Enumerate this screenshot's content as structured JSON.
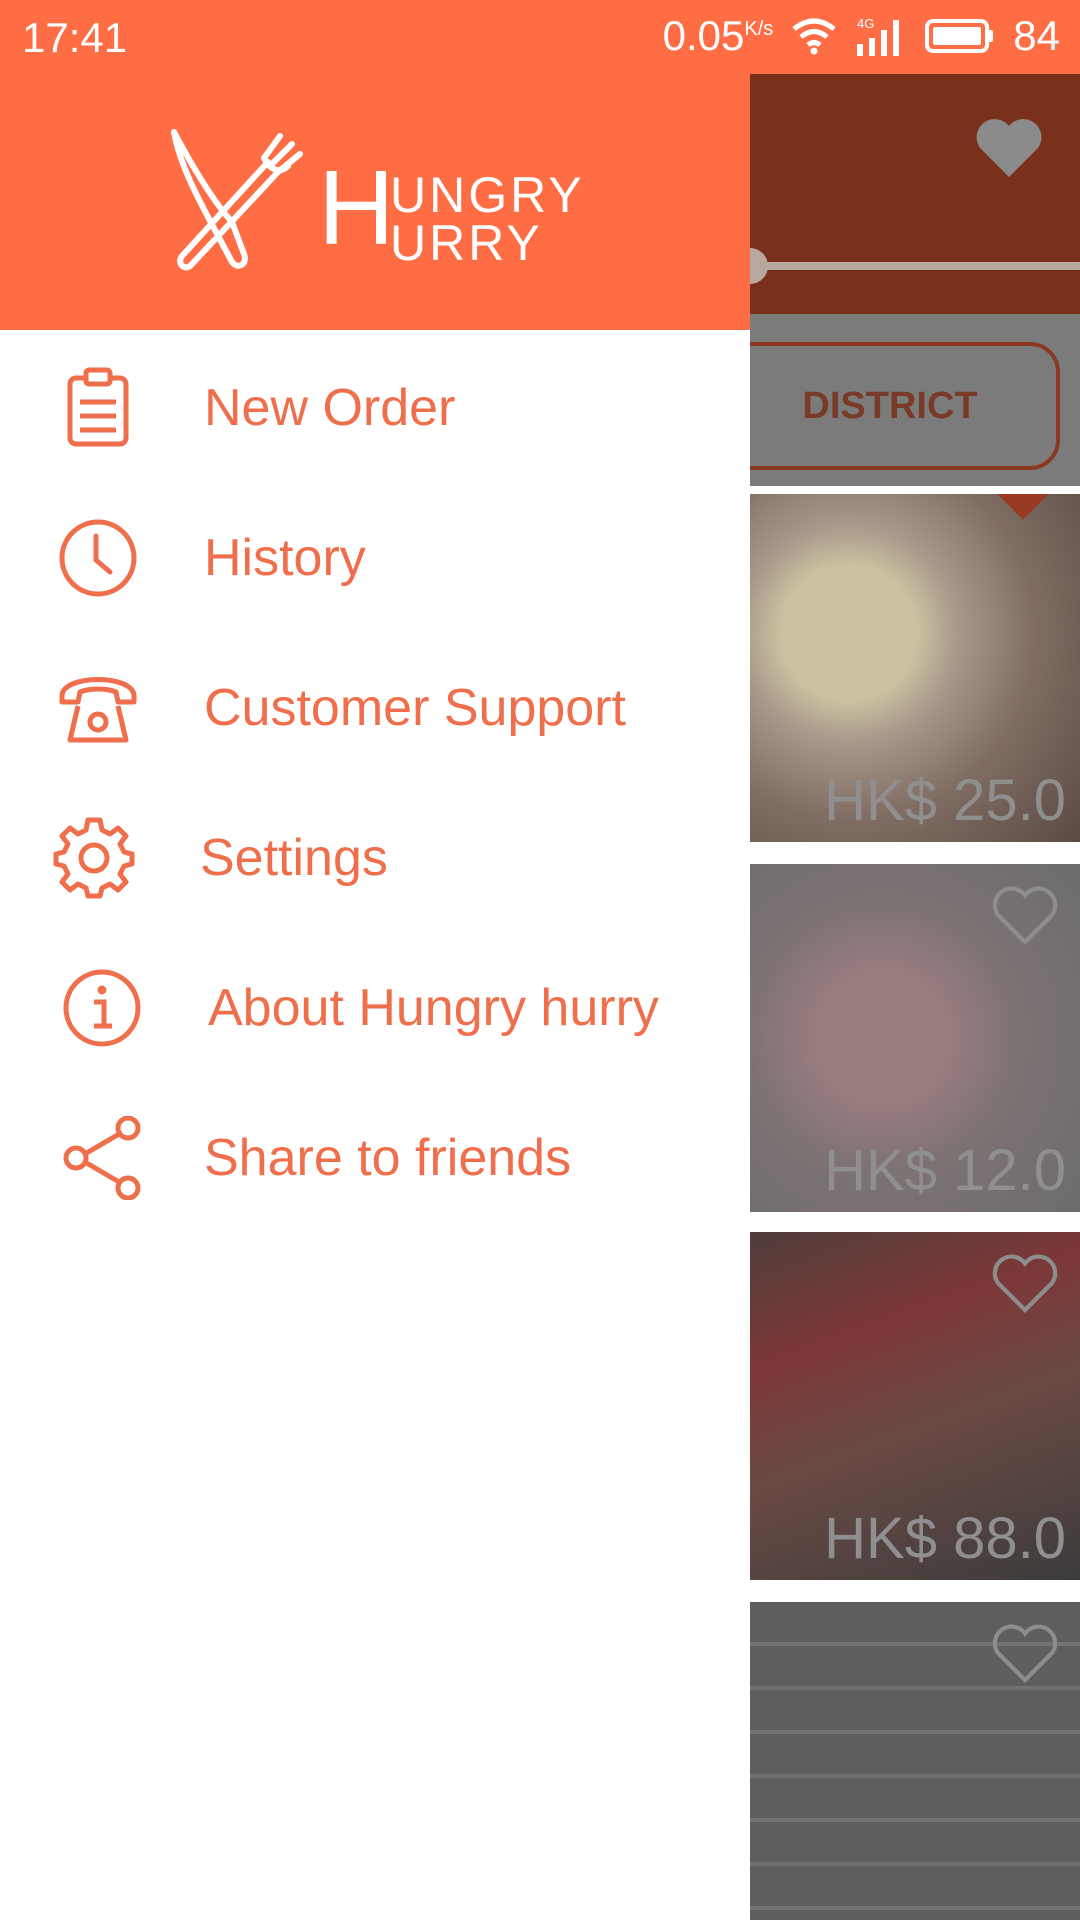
{
  "status_bar": {
    "time": "17:41",
    "speed_value": "0.05",
    "speed_unit": "K/s",
    "network_type": "4G",
    "battery": "84"
  },
  "drawer": {
    "logo": {
      "initial": "H",
      "line1": "UNGRY",
      "line2": "URRY"
    },
    "menu_items": [
      {
        "label": "New Order",
        "icon": "clipboard-icon"
      },
      {
        "label": "History",
        "icon": "clock-icon"
      },
      {
        "label": "Customer Support",
        "icon": "telephone-icon"
      },
      {
        "label": "Settings",
        "icon": "gear-icon"
      },
      {
        "label": "About Hungry hurry",
        "icon": "info-icon"
      },
      {
        "label": "Share to friends",
        "icon": "share-icon"
      }
    ]
  },
  "background": {
    "filter_button": "DISTRICT",
    "cards": [
      {
        "price": "HK$ 25.0",
        "favorited": true
      },
      {
        "price": "HK$ 12.0",
        "favorited": false
      },
      {
        "price": "HK$ 88.0",
        "favorited": false
      },
      {
        "price": "",
        "favorited": false
      }
    ]
  },
  "colors": {
    "brand": "#ff6d45",
    "menu_text": "#ef6f4c",
    "scrim": "rgba(0,0,0,0.5)"
  }
}
